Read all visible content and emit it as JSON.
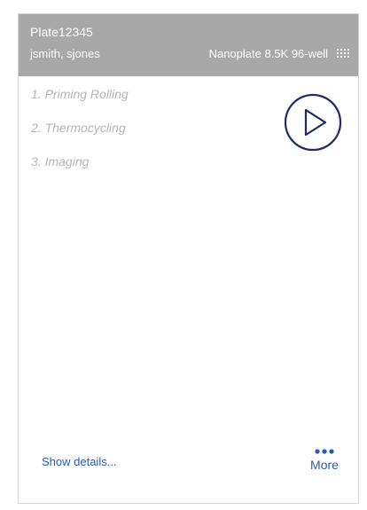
{
  "header": {
    "plate_name": "Plate12345",
    "owners": "jsmith, sjones",
    "plate_type": "Nanoplate 8.5K 96-well",
    "plate_icon": "plate-grid-icon"
  },
  "steps": [
    {
      "number": "1.",
      "label": "Priming Rolling"
    },
    {
      "number": "2.",
      "label": "Thermocycling"
    },
    {
      "number": "3.",
      "label": "Imaging"
    }
  ],
  "actions": {
    "run_icon": "play-icon",
    "show_details": "Show details...",
    "more_label": "More",
    "more_icon": "ellipsis-icon"
  },
  "colors": {
    "header_bg": "#a8a8a8",
    "accent": "#2a5bb0",
    "play_icon": "#1f2a6e",
    "step_text": "#b5b5b5"
  }
}
